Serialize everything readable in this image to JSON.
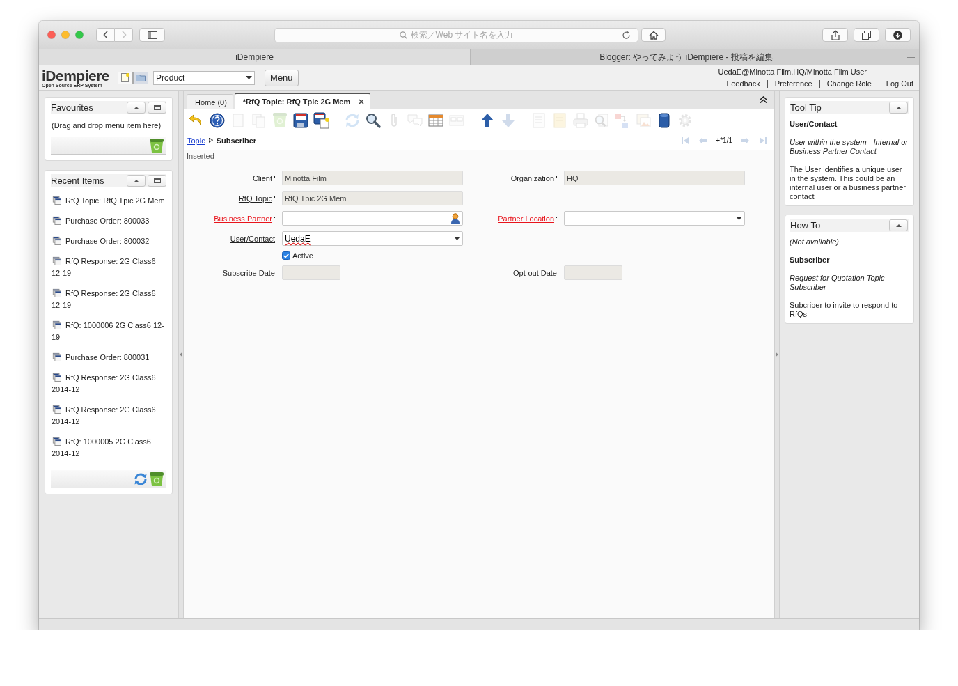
{
  "browser": {
    "address_placeholder": "検索／Web サイト名を入力",
    "tabs": [
      {
        "label": "iDempiere",
        "selected": true
      },
      {
        "label": "Blogger: やってみよう iDempiere - 投稿を編集",
        "selected": false
      }
    ]
  },
  "header": {
    "logo": "iDempiere",
    "logo_subtitle": "Open Source ERP System",
    "menu_search": "Product",
    "menu_button": "Menu",
    "user": "UedaE@Minotta Film.HQ/Minotta Film User",
    "links": [
      "Feedback",
      "Preference",
      "Change Role",
      "Log Out"
    ]
  },
  "favourites": {
    "title": "Favourites",
    "hint": "(Drag and drop menu item here)"
  },
  "recent_items": {
    "title": "Recent Items",
    "items": [
      "RfQ Topic: RfQ Tpic 2G Mem",
      "Purchase Order: 800033",
      "Purchase Order: 800032",
      "RfQ Response: 2G Class6 12-19",
      "RfQ Response: 2G Class6 12-19",
      "RfQ: 1000006 2G Class6 12-19",
      "Purchase Order: 800031",
      "RfQ Response: 2G Class6 2014-12",
      "RfQ Response: 2G Class6 2014-12",
      "RfQ: 1000005 2G Class6 2014-12"
    ]
  },
  "window_tabs": [
    {
      "label": "Home (0)",
      "selected": false,
      "closable": false
    },
    {
      "label": "*RfQ Topic: RfQ Tpic 2G Mem",
      "selected": true,
      "closable": true
    }
  ],
  "toolbar": [
    {
      "kind": "undo",
      "disabled": false
    },
    {
      "kind": "help",
      "disabled": false
    },
    {
      "kind": "new",
      "disabled": true
    },
    {
      "kind": "copy",
      "disabled": true
    },
    {
      "kind": "delete",
      "disabled": true
    },
    {
      "kind": "save",
      "disabled": false
    },
    {
      "kind": "save_new",
      "disabled": false
    },
    {
      "kind": "refresh",
      "disabled": true
    },
    {
      "kind": "find",
      "disabled": false
    },
    {
      "kind": "attachment",
      "disabled": true
    },
    {
      "kind": "chat",
      "disabled": true
    },
    {
      "kind": "grid",
      "disabled": false
    },
    {
      "kind": "multi",
      "disabled": true
    },
    {
      "kind": "up",
      "disabled": false
    },
    {
      "kind": "down",
      "disabled": true
    },
    {
      "kind": "report",
      "disabled": true
    },
    {
      "kind": "archive",
      "disabled": true
    },
    {
      "kind": "print",
      "disabled": true
    },
    {
      "kind": "zoom_across",
      "disabled": true
    },
    {
      "kind": "workflow",
      "disabled": true
    },
    {
      "kind": "image",
      "disabled": true
    },
    {
      "kind": "product_info",
      "disabled": false
    },
    {
      "kind": "process",
      "disabled": true
    }
  ],
  "breadcrumb": {
    "parent": "Topic",
    "current": "Subscriber"
  },
  "record_nav": {
    "buttons": [
      {
        "kind": "first",
        "disabled": true
      },
      {
        "kind": "previous",
        "disabled": true
      },
      {
        "kind": "next",
        "disabled": true
      },
      {
        "kind": "last",
        "disabled": true
      }
    ],
    "position": "+*1/1"
  },
  "status": "Inserted",
  "form": {
    "rows": [
      [
        {
          "label": "Client",
          "kind": "text",
          "value": "Minotta Film",
          "readonly": true,
          "mandatory": true,
          "missing": false,
          "zoom": false
        },
        {
          "label": "Organization",
          "kind": "text",
          "value": "HQ",
          "readonly": true,
          "mandatory": true,
          "missing": false,
          "zoom": true
        }
      ],
      [
        {
          "label": "RfQ Topic",
          "kind": "text",
          "value": "RfQ Tpic 2G Mem",
          "readonly": true,
          "mandatory": true,
          "missing": false,
          "zoom": true
        }
      ],
      [
        {
          "label": "Business Partner",
          "kind": "search",
          "readonly": false,
          "mandatory": true,
          "missing": true,
          "zoom": true
        },
        {
          "label": "Partner Location",
          "kind": "select",
          "readonly": false,
          "mandatory": true,
          "missing": true,
          "zoom": true
        }
      ],
      [
        {
          "label": "User/Contact",
          "kind": "select",
          "value": "UedaE",
          "readonly": false,
          "mandatory": false,
          "missing": false,
          "zoom": true,
          "misspelled": true
        }
      ],
      [
        {
          "label": "Active",
          "kind": "checkbox",
          "checked": true
        }
      ],
      [
        {
          "label": "Subscribe Date",
          "kind": "date",
          "readonly": true,
          "mandatory": false,
          "missing": false,
          "zoom": false
        },
        {
          "label": "Opt-out Date",
          "kind": "date",
          "readonly": true,
          "mandatory": false,
          "missing": false,
          "zoom": false
        }
      ]
    ]
  },
  "tooltip": {
    "title": "Tool Tip",
    "lines": [
      {
        "kind": "bold",
        "text": "User/Contact"
      },
      {
        "kind": "italic",
        "text": "User within the system - Internal or Business Partner Contact"
      },
      {
        "kind": "plain",
        "text": "The User identifies a unique user in the system. This could be an internal user or a business partner contact"
      }
    ]
  },
  "how_to": {
    "title": "How To",
    "lines": [
      {
        "kind": "italic",
        "text": "(Not available)"
      },
      {
        "kind": "bold",
        "text": "Subscriber"
      },
      {
        "kind": "italic",
        "text": "Request for Quotation Topic Subscriber"
      },
      {
        "kind": "plain",
        "text": "Subcriber to invite to respond to RfQs"
      }
    ]
  }
}
